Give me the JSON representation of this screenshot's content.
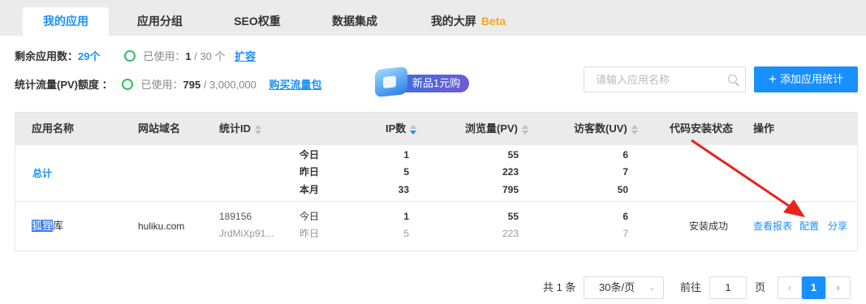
{
  "tabs": [
    {
      "label": "我的应用"
    },
    {
      "label": "应用分组"
    },
    {
      "label": "SEO权重"
    },
    {
      "label": "数据集成"
    },
    {
      "label": "我的大屏",
      "badge": "Beta"
    }
  ],
  "quota": {
    "apps_label": "剩余应用数：",
    "apps_value": "29个",
    "apps_used_prefix": "已使用：",
    "apps_used": "1",
    "apps_total": " / 30 个",
    "expand_link": "扩容",
    "pv_label": "统计流量(PV)额度 ：",
    "pv_used_prefix": "已使用：",
    "pv_used": "795",
    "pv_total": " / 3,000,000",
    "buy_link": "购买流量包"
  },
  "promo": {
    "label": "新品1元购"
  },
  "search": {
    "placeholder": "请输入应用名称"
  },
  "add_button": {
    "label": "添加应用统计"
  },
  "table": {
    "headers": {
      "app_name": "应用名称",
      "domain": "网站域名",
      "stat_id": "统计ID",
      "ip": "IP数",
      "pv": "浏览量(PV)",
      "uv": "访客数(UV)",
      "install_status": "代码安装状态",
      "actions": "操作"
    },
    "total": {
      "label": "总计",
      "periods": [
        "今日",
        "昨日",
        "本月"
      ],
      "ip": [
        "1",
        "5",
        "33"
      ],
      "pv": [
        "55",
        "223",
        "795"
      ],
      "uv": [
        "6",
        "7",
        "50"
      ]
    },
    "row": {
      "name_sel": "狐狸",
      "name_rest": "库",
      "domain": "huliku.com",
      "id_line1": "189156",
      "id_line2": "JrdMiXp91...",
      "periods": [
        "今日",
        "昨日"
      ],
      "ip": [
        "1",
        "5"
      ],
      "pv": [
        "55",
        "223"
      ],
      "uv": [
        "6",
        "7"
      ],
      "status": "安装成功",
      "actions": [
        "查看报表",
        "配置",
        "分享"
      ]
    }
  },
  "pagination": {
    "total_text": "共 1 条",
    "page_size": "30条/页",
    "goto_label": "前往",
    "goto_value": "1",
    "page_suffix": "页",
    "current_page": "1",
    "prev_icon": "chevron-left-icon",
    "next_icon": "chevron-right-icon"
  },
  "colors": {
    "accent": "#1890ff",
    "success": "#2fc25b",
    "beta": "#f5a623",
    "annotation_arrow": "#e8231a"
  }
}
